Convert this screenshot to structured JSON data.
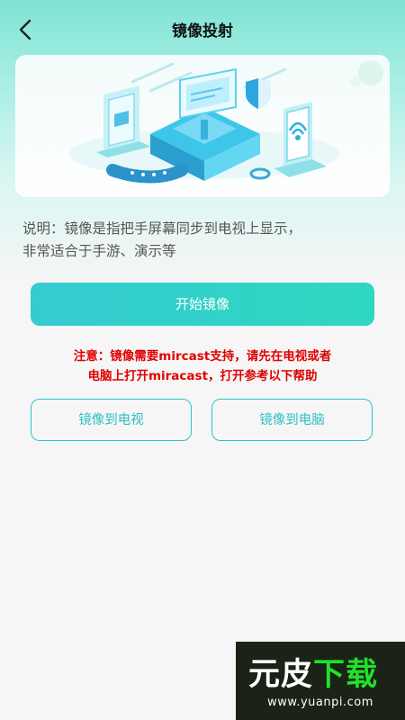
{
  "header": {
    "title": "镜像投射",
    "back_icon": "chevron-left-icon"
  },
  "banner": {
    "illustration": "screen-mirroring-isometric-illustration"
  },
  "description": {
    "line1": "说明：镜像是指把手屏幕同步到电视上显示，",
    "line2": "非常适合于手游、演示等"
  },
  "actions": {
    "start_label": "开始镜像",
    "mirror_tv_label": "镜像到电视",
    "mirror_pc_label": "镜像到电脑"
  },
  "notice": {
    "line1": "注意：镜像需要mircast支持，请先在电视或者",
    "line2": "电脑上打开miracast，打开参考以下帮助"
  },
  "watermark": {
    "part1": "元皮",
    "part2": "下载",
    "url": "www.yuanpi.com"
  },
  "colors": {
    "accent": "#2fc3c6",
    "notice": "#e00000"
  }
}
